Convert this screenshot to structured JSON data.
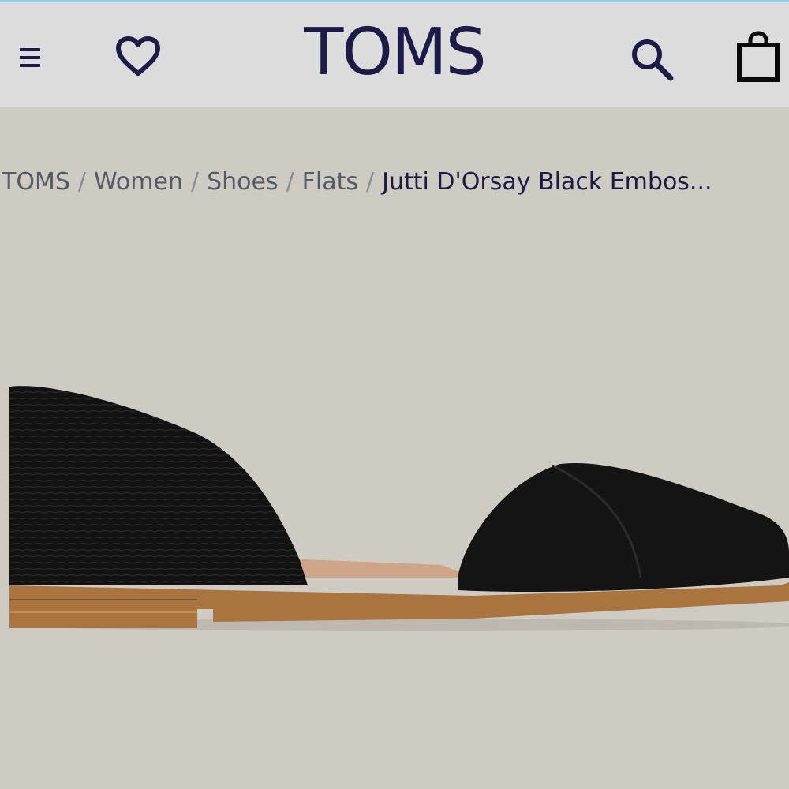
{
  "header": {
    "brand": "TOMS",
    "icons": {
      "menu": "hamburger-menu-icon",
      "favorites": "heart-icon",
      "search": "search-icon",
      "bag": "shopping-bag-icon"
    },
    "brand_color": "#1d1a47"
  },
  "breadcrumb": {
    "items": [
      "TOMS",
      "Women",
      "Shoes",
      "Flats"
    ],
    "separator": "/",
    "current": "Jutti D'Orsay Black Embos..."
  },
  "product": {
    "image_alt": "black d'orsay flat shoe",
    "colors": {
      "upper": "#141414",
      "sole": "#a9743f",
      "background": "#cecbc3"
    }
  }
}
